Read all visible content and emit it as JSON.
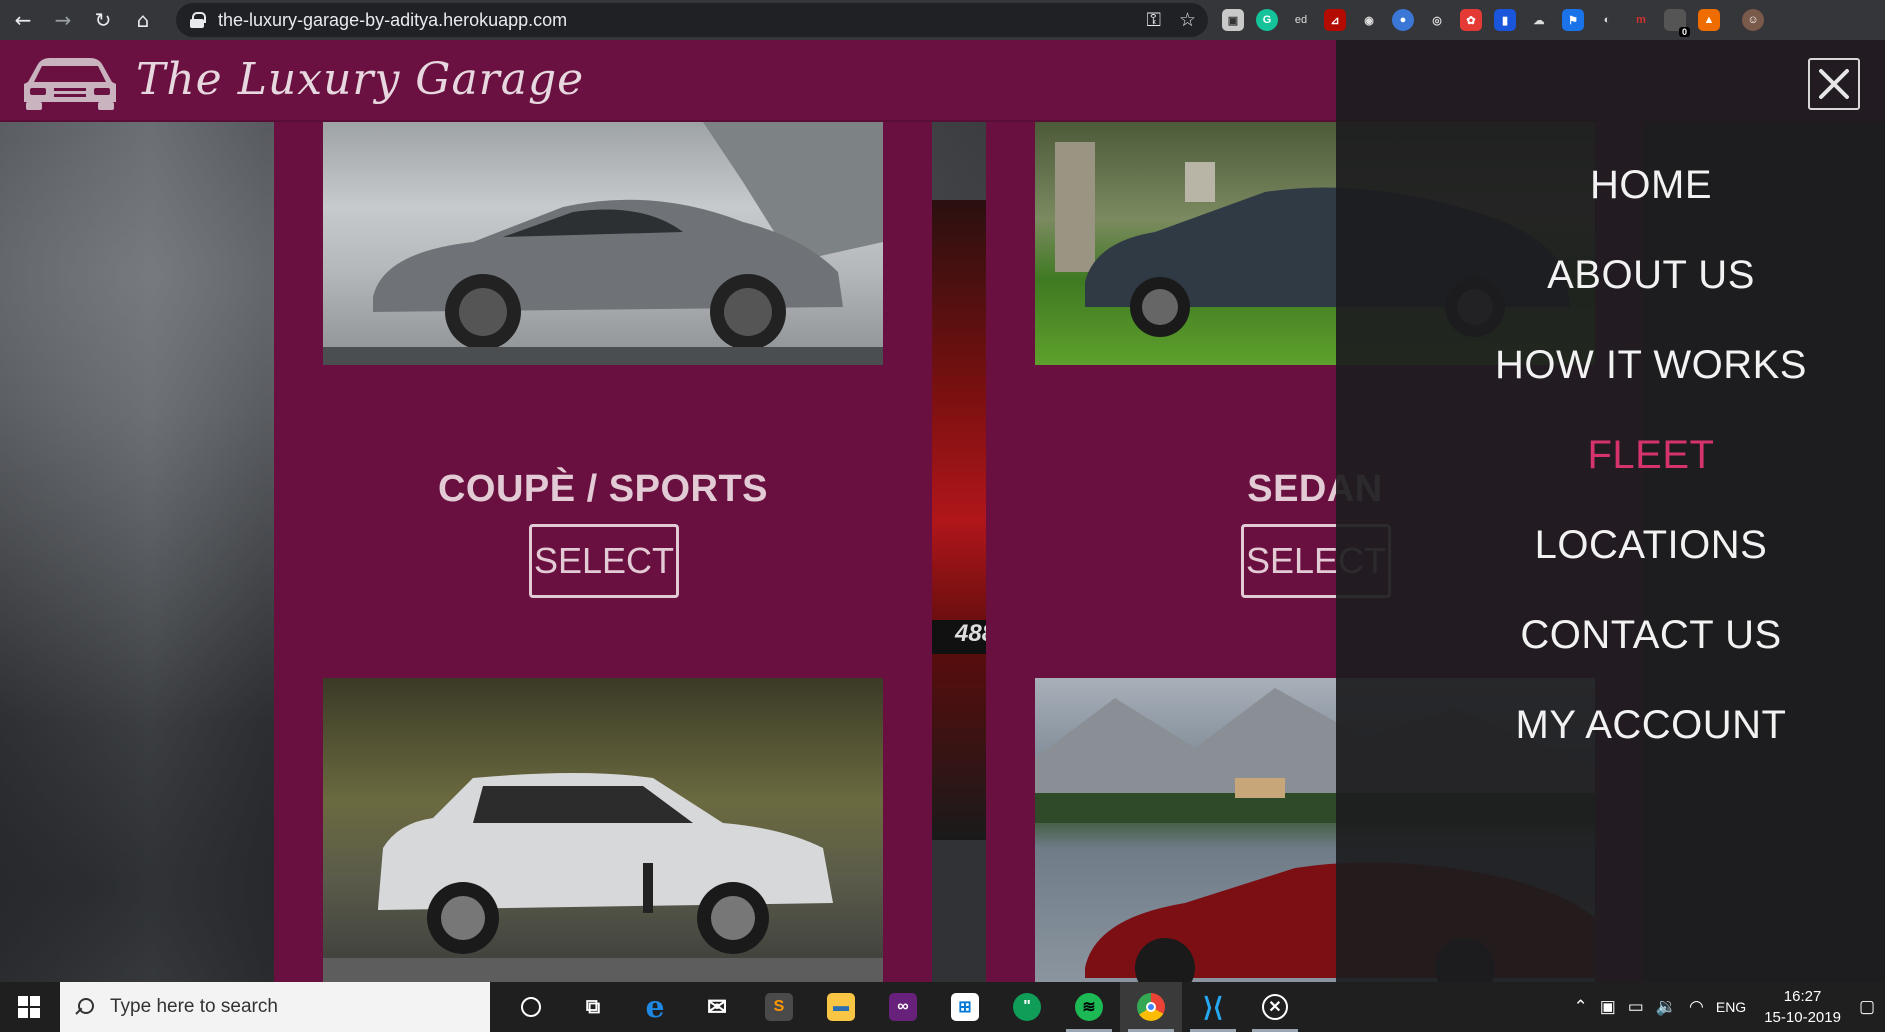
{
  "browser": {
    "url": "the-luxury-garage-by-aditya.herokuapp.com",
    "ext_badge_count": "0"
  },
  "site": {
    "brand": "The Luxury Garage"
  },
  "cards": [
    {
      "title": "COUPÈ / SPORTS",
      "button": "SELECT"
    },
    {
      "title": "SEDAN",
      "button": "SELECT"
    }
  ],
  "sidenav": {
    "close_symbol": "✕",
    "items": [
      "HOME",
      "ABOUT US",
      "HOW IT WORKS",
      "FLEET",
      "LOCATIONS",
      "CONTACT US",
      "MY ACCOUNT"
    ],
    "active": "FLEET"
  },
  "taskbar": {
    "search_placeholder": "Type here to search",
    "language": "ENG",
    "time": "16:27",
    "date": "15-10-2019"
  },
  "colors": {
    "brand_bg": "#6b1142",
    "card_bg": "#6a1040",
    "active_nav": "#d6336c"
  }
}
